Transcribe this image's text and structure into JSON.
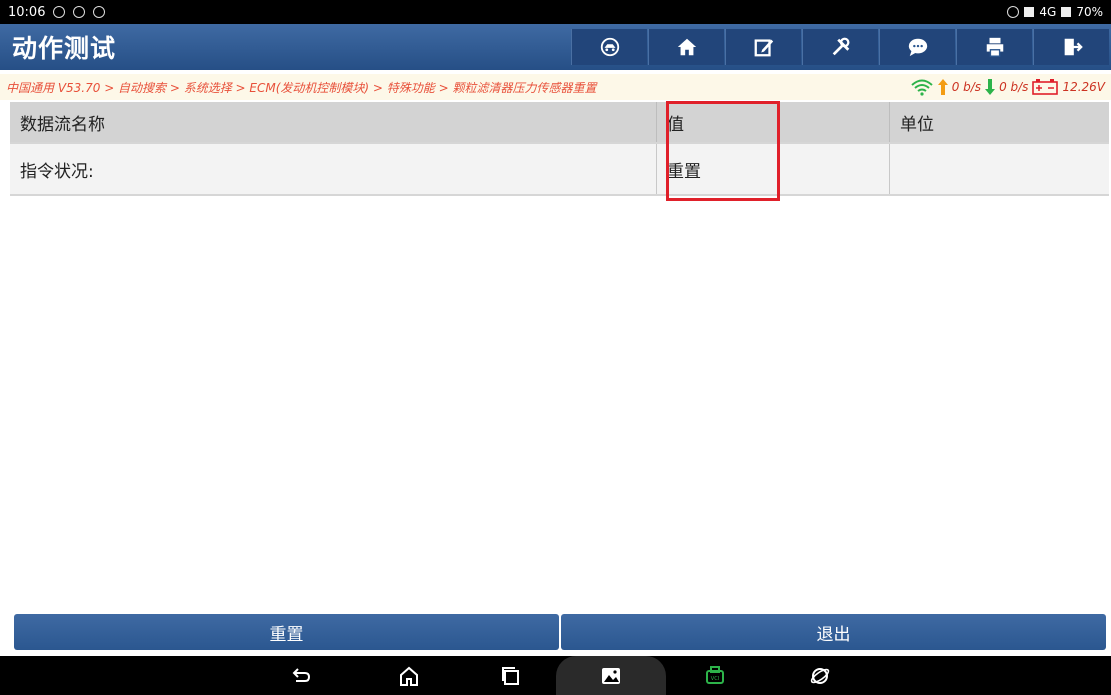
{
  "status_bar": {
    "time": "10:06",
    "network": "4G",
    "battery": "70%"
  },
  "header": {
    "title": "动作测试",
    "toolbar": [
      {
        "name": "vehicle-icon"
      },
      {
        "name": "home-icon"
      },
      {
        "name": "edit-icon"
      },
      {
        "name": "tools-icon"
      },
      {
        "name": "message-icon"
      },
      {
        "name": "print-icon"
      },
      {
        "name": "exit-icon"
      }
    ]
  },
  "breadcrumb": {
    "text": "中国通用 V53.70 > 自动搜索 > 系统选择 > ECM(发动机控制模块) > 特殊功能 > 颗粒滤清器压力传感器重置",
    "upload": "0 b/s",
    "download": "0 b/s",
    "voltage": "12.26V"
  },
  "table": {
    "headers": {
      "name": "数据流名称",
      "value": "值",
      "unit": "单位"
    },
    "rows": [
      {
        "name": "指令状况:",
        "value": "重置",
        "unit": ""
      }
    ]
  },
  "buttons": {
    "reset": "重置",
    "exit": "退出"
  },
  "colors": {
    "header": "#2b5790",
    "highlight": "#e0202a",
    "breadcrumb_text": "#e8503a"
  }
}
